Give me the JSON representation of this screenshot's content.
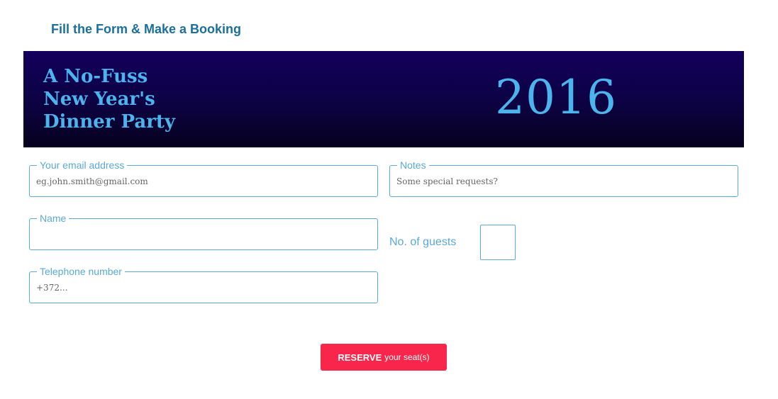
{
  "header": {
    "title": "Fill the Form & Make a Booking"
  },
  "banner": {
    "title_lines": [
      "A No-Fuss",
      "New Year's",
      "Dinner Party"
    ],
    "year": "2016"
  },
  "form": {
    "email": {
      "label": "Your email address",
      "placeholder": "eg.john.smith@gmail.com",
      "value": ""
    },
    "notes": {
      "label": "Notes",
      "placeholder": "Some special requests?",
      "value": ""
    },
    "name": {
      "label": "Name",
      "placeholder": "",
      "value": ""
    },
    "telephone": {
      "label": "Telephone number",
      "placeholder": "+372...",
      "value": ""
    },
    "guests": {
      "label": "No. of guests",
      "value": ""
    }
  },
  "submit": {
    "strong_label": "RESERVE",
    "light_label": "your seat(s)"
  },
  "colors": {
    "accent": "#5aa9d6",
    "title": "#1a6f9e",
    "banner_bg": "#0c0242",
    "banner_text": "#4bb4ec",
    "button": "#f8264a"
  }
}
